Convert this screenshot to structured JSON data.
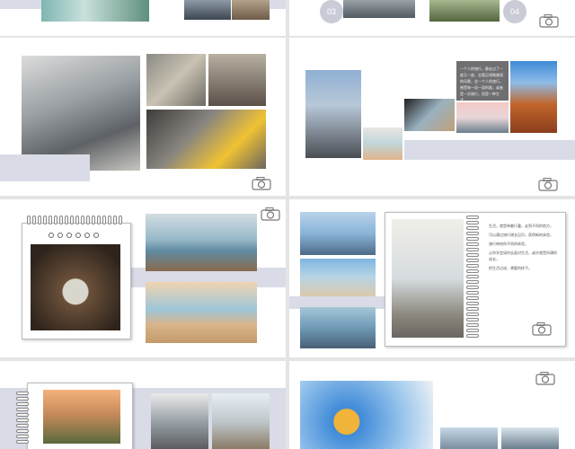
{
  "badges": {
    "b1": "03",
    "b2": "04"
  },
  "slide4_card": {
    "text": "一个人的旅行，静走过了一座又一座，去看见领略美丽的风景，会一个人的旅行，感受每一段一段的路，或者是一次旅行，而是一种生活。"
  },
  "slide6_text": {
    "p1": "生活，就是带着行囊，走到不同的地方，",
    "p2": "可以通过旅行增长见识，获得新的体验，",
    "p3": "旅行带给你不同的体验，",
    "p4": "让你学会如何去面对生活，或许就是所谓的成长，",
    "p5": "把生活过成，想要的样子。"
  },
  "colors": {
    "band": "#d9dce6",
    "badge": "#c9ccd6",
    "card": "#6f6f72"
  }
}
